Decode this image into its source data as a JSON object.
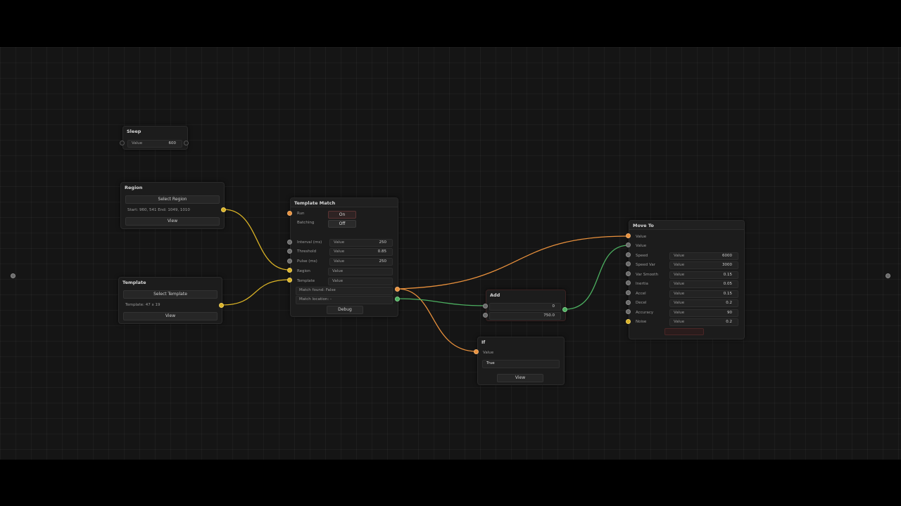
{
  "colors": {
    "canvas": "#151515",
    "wire_orange": "#e8903c",
    "wire_yellow": "#d9b226",
    "wire_green": "#4caf60"
  },
  "sleep": {
    "title": "Sleep",
    "field_label": "Value",
    "field_value": "600"
  },
  "region": {
    "title": "Region",
    "button": "Select Region",
    "info": "Start: 960, 541  End: 1049, 1010",
    "view": "View"
  },
  "template": {
    "title": "Template",
    "button": "Select Template",
    "info": "Template: 47 x 19",
    "view": "View"
  },
  "template_match": {
    "title": "Template Match",
    "run_label": "Run",
    "run_value": "On",
    "batching_label": "Batching",
    "batching_value": "Off",
    "interval_label": "Interval (ms)",
    "interval_field": "Value",
    "interval_value": "250",
    "threshold_label": "Threshold",
    "threshold_field": "Value",
    "threshold_value": "0.85",
    "pulse_label": "Pulse (ms)",
    "pulse_field": "Value",
    "pulse_value": "250",
    "region_label": "Region",
    "region_field": "Value",
    "template_label": "Template",
    "template_field": "Value",
    "match_found": "Match found: False",
    "match_location": "Match location: -",
    "debug": "Debug"
  },
  "add": {
    "title": "Add",
    "a_value": "0",
    "b_value": "750.0"
  },
  "if_node": {
    "title": "If",
    "value_label": "Value",
    "result": "True",
    "view": "View"
  },
  "move_to": {
    "title": "Move To",
    "input1": "Value",
    "input2": "Value",
    "params": [
      {
        "label": "Speed",
        "field": "Value",
        "value": "6000"
      },
      {
        "label": "Speed Var",
        "field": "Value",
        "value": "3000"
      },
      {
        "label": "Var Smooth",
        "field": "Value",
        "value": "0.15"
      },
      {
        "label": "Inertia",
        "field": "Value",
        "value": "0.05"
      },
      {
        "label": "Accel",
        "field": "Value",
        "value": "0.15"
      },
      {
        "label": "Decel",
        "field": "Value",
        "value": "0.2"
      },
      {
        "label": "Accuracy",
        "field": "Value",
        "value": "90"
      },
      {
        "label": "Noise",
        "field": "Value",
        "value": "0.2"
      }
    ]
  }
}
